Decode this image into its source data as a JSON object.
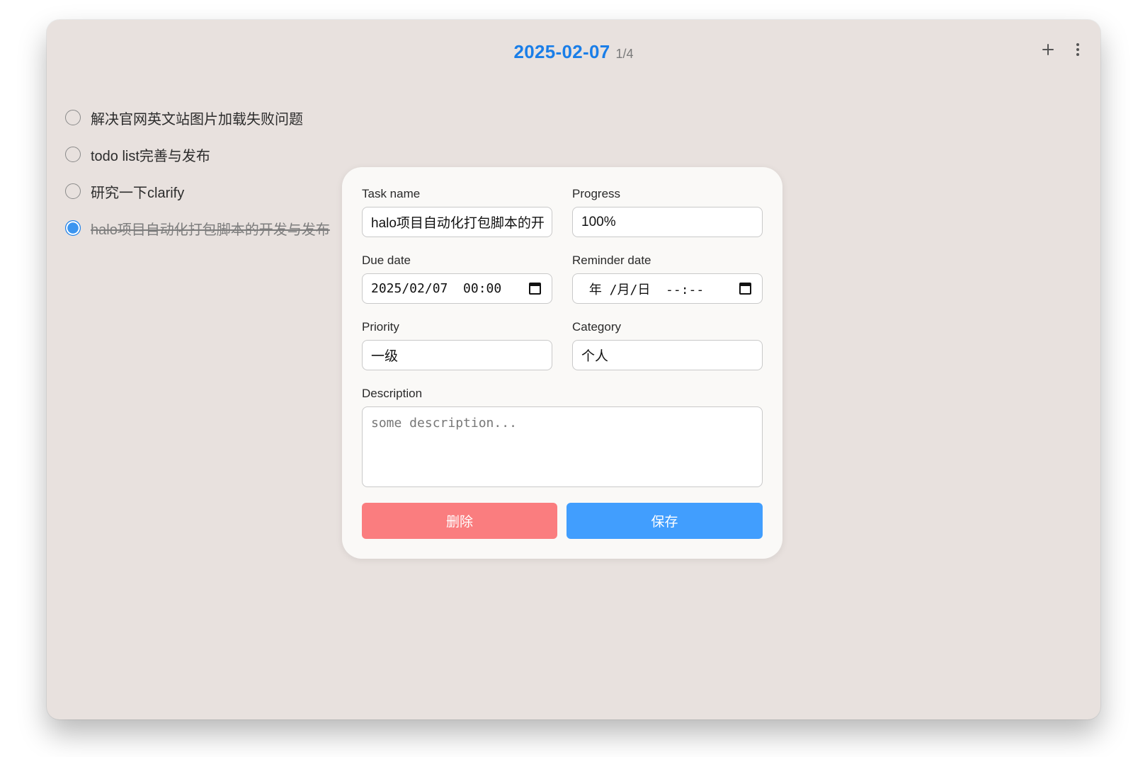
{
  "header": {
    "date": "2025-02-07",
    "count": "1/4"
  },
  "tasks": [
    {
      "label": "解决官网英文站图片加载失败问题",
      "done": false
    },
    {
      "label": "todo list完善与发布",
      "done": false
    },
    {
      "label": "研究一下clarify",
      "done": false
    },
    {
      "label": "halo项目自动化打包脚本的开发与发布",
      "done": true
    }
  ],
  "editor": {
    "task_name_label": "Task name",
    "task_name_value": "halo项目自动化打包脚本的开",
    "progress_label": "Progress",
    "progress_value": "100%",
    "due_date_label": "Due date",
    "due_date_value": "2025/02/07  00:00",
    "reminder_date_label": "Reminder date",
    "reminder_date_value": " 年 /月/日  --:--",
    "priority_label": "Priority",
    "priority_value": "一级",
    "category_label": "Category",
    "category_value": "个人",
    "description_label": "Description",
    "description_placeholder": "some description...",
    "delete_label": "删除",
    "save_label": "保存"
  },
  "colors": {
    "accent": "#1a7ee8",
    "delete": "#fa7d7f",
    "save": "#419efe",
    "background": "#e8e1de"
  }
}
